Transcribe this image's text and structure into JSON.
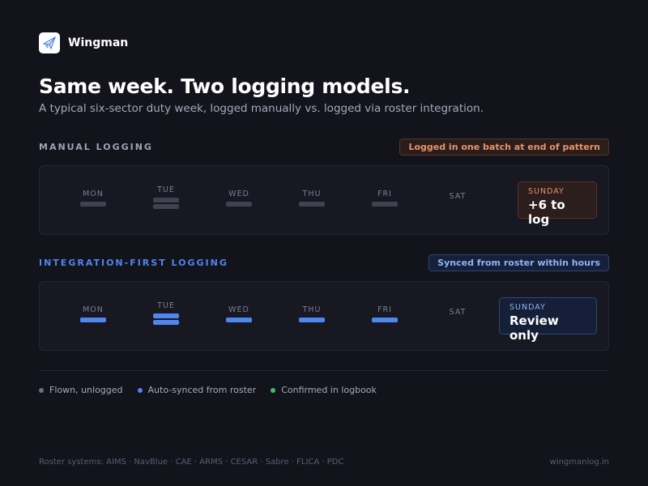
{
  "brand": {
    "name": "Wingman",
    "logo_icon": "paper-plane-icon"
  },
  "headline": "Same week. Two logging models.",
  "subhead": "A typical six-sector duty week, logged manually vs. logged via roster integration.",
  "manual": {
    "label": "MANUAL LOGGING",
    "label_color": "#9ea2b3",
    "badge": "Logged in one batch at end of pattern",
    "days": [
      {
        "name": "MON",
        "bars": 1
      },
      {
        "name": "TUE",
        "bars": 2
      },
      {
        "name": "WED",
        "bars": 1
      },
      {
        "name": "THU",
        "bars": 1
      },
      {
        "name": "FRI",
        "bars": 1
      },
      {
        "name": "SAT",
        "bars": 0
      }
    ],
    "sunday": {
      "label": "SUNDAY",
      "value": "+6 to log"
    }
  },
  "integration": {
    "label": "INTEGRATION-FIRST LOGGING",
    "label_color": "#4f86f0",
    "badge": "Synced from roster within hours",
    "days": [
      {
        "name": "MON",
        "bars": 1
      },
      {
        "name": "TUE",
        "bars": 2
      },
      {
        "name": "WED",
        "bars": 1
      },
      {
        "name": "THU",
        "bars": 1
      },
      {
        "name": "FRI",
        "bars": 1
      },
      {
        "name": "SAT",
        "bars": 0
      }
    ],
    "sunday": {
      "label": "SUNDAY",
      "value": "Review only"
    }
  },
  "legend": [
    {
      "label": "Flown, unlogged",
      "color": "#6b6f80"
    },
    {
      "label": "Auto-synced from roster",
      "color": "#4f86f0"
    },
    {
      "label": "Confirmed in logbook",
      "color": "#3fbf62"
    }
  ],
  "footer": {
    "rosters": "Roster systems: AIMS · NavBlue · CAE · ARMS · CESAR · Sabre · FLICA · PDC",
    "site": "wingmanlog.in"
  }
}
